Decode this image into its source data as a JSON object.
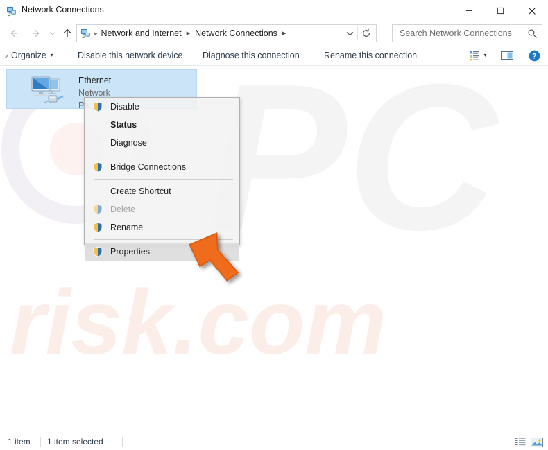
{
  "window": {
    "title": "Network Connections",
    "title_icon": "network-connections-icon",
    "minimize_label": "—",
    "maximize_label": "□",
    "close_label": "✕"
  },
  "nav": {
    "back_icon": "arrow-left-icon",
    "forward_icon": "arrow-right-icon",
    "recent_icon": "chevron-down-icon",
    "up_icon": "arrow-up-icon"
  },
  "address": {
    "icon": "network-connections-icon",
    "leading_separator": "▸",
    "crumbs": [
      {
        "label": "Network and Internet",
        "arrow": "▸"
      },
      {
        "label": "Network Connections",
        "arrow": "▸"
      }
    ],
    "dropdown_icon": "chevron-down-icon",
    "refresh_icon": "refresh-icon"
  },
  "search": {
    "placeholder": "Search Network Connections",
    "value": "",
    "icon": "search-icon"
  },
  "commandbar": {
    "organize": {
      "label": "Organize",
      "caret": "▾"
    },
    "disable": {
      "label": "Disable this network device"
    },
    "diagnose": {
      "label": "Diagnose this connection"
    },
    "rename": {
      "label": "Rename this connection"
    },
    "overflow": {
      "label": "»"
    },
    "view_mode": {
      "icon": "change-view-icon",
      "caret": "▾"
    },
    "preview_pane": {
      "icon": "preview-pane-icon"
    },
    "help": {
      "icon": "help-icon"
    }
  },
  "items": [
    {
      "name": "Ethernet",
      "network": "Network",
      "adapter": "Pa",
      "icon": "ethernet-adapter-icon",
      "selected": true
    }
  ],
  "context_menu": {
    "entries": [
      {
        "label": "Disable",
        "type": "item",
        "icon": "shield-icon",
        "bold": false,
        "disabled": false,
        "highlighted": false
      },
      {
        "label": "Status",
        "type": "item",
        "icon": "",
        "bold": true,
        "disabled": false,
        "highlighted": false
      },
      {
        "label": "Diagnose",
        "type": "item",
        "icon": "",
        "bold": false,
        "disabled": false,
        "highlighted": false
      },
      {
        "label": "",
        "type": "separator"
      },
      {
        "label": "Bridge Connections",
        "type": "item",
        "icon": "shield-icon",
        "bold": false,
        "disabled": false,
        "highlighted": false
      },
      {
        "label": "",
        "type": "separator"
      },
      {
        "label": "Create Shortcut",
        "type": "item",
        "icon": "",
        "bold": false,
        "disabled": false,
        "highlighted": false
      },
      {
        "label": "Delete",
        "type": "item",
        "icon": "shield-icon",
        "bold": false,
        "disabled": true,
        "highlighted": false
      },
      {
        "label": "Rename",
        "type": "item",
        "icon": "shield-icon",
        "bold": false,
        "disabled": false,
        "highlighted": false
      },
      {
        "label": "",
        "type": "separator"
      },
      {
        "label": "Properties",
        "type": "item",
        "icon": "shield-icon",
        "bold": false,
        "disabled": false,
        "highlighted": true
      }
    ]
  },
  "statusbar": {
    "item_count": "1 item",
    "selection": "1 item selected",
    "details_view_icon": "details-view-icon",
    "large_icons_view_icon": "large-icons-view-icon"
  },
  "cursor": {
    "icon": "arrow-cursor-icon",
    "color": "#ef6c1a"
  },
  "watermark": {
    "text": "risk.com",
    "prefix_letters": "PC",
    "color": "#fbeee8",
    "accent_color": "#fdf0ea"
  },
  "colors": {
    "selection_fill": "#cce4f7",
    "selection_border": "#b4d8f5",
    "menu_bg": "#f2f2f2",
    "menu_border": "#b0b0b0",
    "menu_highlight": "#d8d8d8",
    "command_text": "#2b3a4a",
    "accent_blue": "#1a79c8",
    "shield_gold": "#f2c14b",
    "shield_blue": "#2b6cb0"
  }
}
